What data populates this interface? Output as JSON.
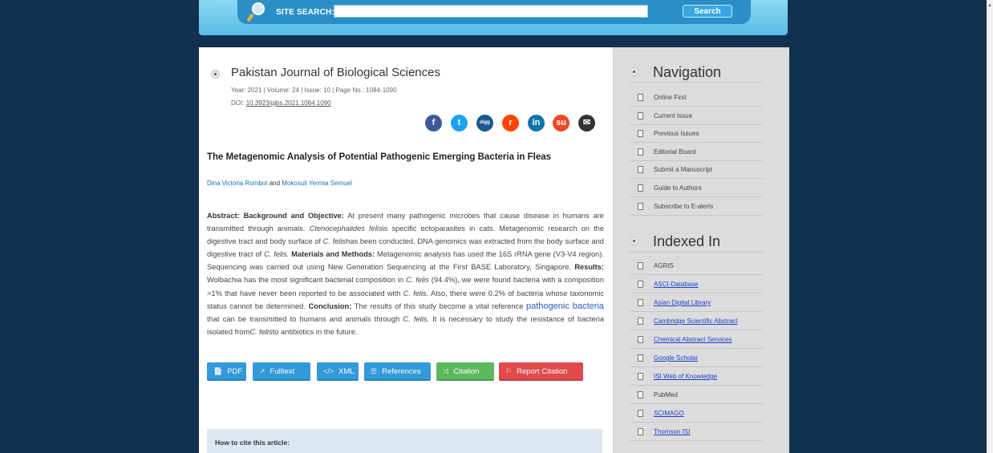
{
  "header": {
    "search_label": "SITE SEARCH:",
    "search_value": "",
    "search_button": "Search"
  },
  "journal": {
    "title": "Pakistan Journal of Biological Sciences",
    "meta": "Year: 2021 | Volume: 24 | Issue: 10 | Page No.: 1084-1090",
    "doi_label": "DOI:",
    "doi": "10.3923/pjbs.2021.1084.1090"
  },
  "share_icons": [
    {
      "name": "facebook-icon",
      "glyph": "f",
      "color": "#3b5998"
    },
    {
      "name": "twitter-icon",
      "glyph": "t",
      "color": "#1da1f2"
    },
    {
      "name": "digg-icon",
      "glyph": "digg",
      "color": "#1b5891"
    },
    {
      "name": "reddit-icon",
      "glyph": "r",
      "color": "#ff4500"
    },
    {
      "name": "linkedin-icon",
      "glyph": "in",
      "color": "#0e76a8"
    },
    {
      "name": "stumbleupon-icon",
      "glyph": "su",
      "color": "#eb4924"
    },
    {
      "name": "email-icon",
      "glyph": "✉",
      "color": "#333333"
    }
  ],
  "article": {
    "title": "The Metagenomic Analysis of Potential Pathogenic Emerging Bacteria in Fleas",
    "author1": "Dina Victoria Rombot",
    "and": "and",
    "author2": "Mokosuli Yermia Semuel",
    "abstract": {
      "h_abstract": "Abstract:",
      "h_background": "Background and Objective:",
      "t1": "At present many pathogenic microbes that cause disease in humans are transmitted through animals.",
      "i1": "Ctenocephalides felis",
      "t2": "is specific ectoparasites in cats. Metagenomic research on the digestive tract and body surface of",
      "i2": "C. felis",
      "t3": "has been conducted. DNA genomics was extracted from the body surface and digestive tract of",
      "i3": "C. felis.",
      "h_methods": "Materials and Methods:",
      "t4": "Metagenomic analysis has used the 16S rRNA gene (V3-V4 region). Sequencing was carried out using New Generation Sequencing at the First BASE Laboratory, Singapore.",
      "h_results": "Results:",
      "t5": "Wolbachia has the most significant bacterial composition in",
      "i4": "C. felis",
      "t6": "(94.4%), we were found bacteria with a composition >1% that have never been reported to be associated with",
      "i5": "C. felis.",
      "t7": "Also, there were 0.2% of bacteria whose taxonomic status cannot be determined.",
      "h_conclusion": "Conclusion:",
      "t8": "The results of this study become a vital reference",
      "link": "pathogenic bacteria",
      "t9": "that can be transmitted to humans and animals through",
      "i6": "C. felis.",
      "t10": "It is necessary to study the resistance of bacteria isolated from",
      "i7": "C. felis",
      "t11": "to antibiotics in the future."
    }
  },
  "buttons": [
    {
      "label": "PDF",
      "icon": "📄",
      "color": "#3399d8"
    },
    {
      "label": "Fulltext",
      "icon": "↗",
      "color": "#3399d8"
    },
    {
      "label": "XML",
      "icon": "</>",
      "color": "#3399d8"
    },
    {
      "label": "References",
      "icon": "☰",
      "color": "#3399d8"
    },
    {
      "label": "Citation",
      "icon": "⤨",
      "color": "#5cb85c"
    },
    {
      "label": "Report Citation",
      "icon": "⚐",
      "color": "#e04a4a"
    }
  ],
  "cite": {
    "label": "How to cite this article:"
  },
  "navigation": {
    "heading": "Navigation",
    "items": [
      "Online First",
      "Current Issue",
      "Previous Issues",
      "Editorial Board",
      "Submit a Manuscript",
      "Guide to Authors",
      "Subscribe to E-alerts"
    ]
  },
  "indexed": {
    "heading": "Indexed In",
    "items": [
      {
        "label": "AGRIS",
        "link": false
      },
      {
        "label": "ASCI-Database",
        "link": true
      },
      {
        "label": "Asian Digital Library",
        "link": true
      },
      {
        "label": "Cambridge Scientific Abstract",
        "link": true
      },
      {
        "label": "Chemical Abstract Services",
        "link": true
      },
      {
        "label": "Google Scholar",
        "link": true
      },
      {
        "label": "ISI Web of Knowledge",
        "link": true
      },
      {
        "label": "PubMed",
        "link": false
      },
      {
        "label": "SCIMAGO",
        "link": true
      },
      {
        "label": "Thomson ISI",
        "link": true
      }
    ]
  }
}
